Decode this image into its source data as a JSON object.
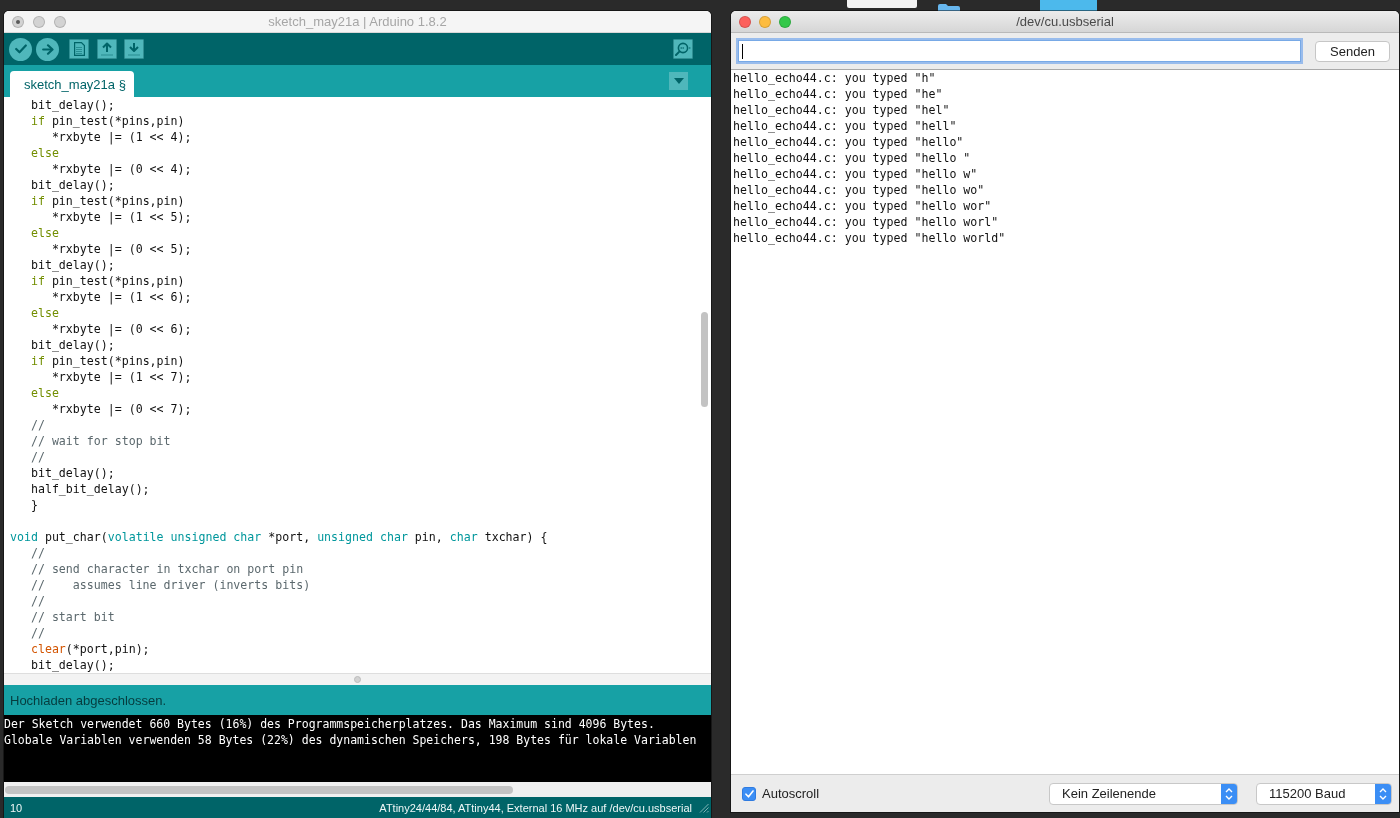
{
  "desktop": {
    "items": [
      {
        "kind": "file"
      },
      {
        "kind": "folder"
      },
      {
        "kind": "tile"
      }
    ]
  },
  "editor_window": {
    "title": "sketch_may21a | Arduino 1.8.2",
    "active": false,
    "edited": true,
    "toolbar": [
      {
        "kind": "verify"
      },
      {
        "kind": "upload"
      },
      {
        "kind": "new"
      },
      {
        "kind": "open"
      },
      {
        "kind": "save"
      },
      {
        "kind": "serial_monitor"
      }
    ],
    "tabs": [
      {
        "label": "sketch_may21a §",
        "selected": true
      }
    ],
    "code_lines": [
      {
        "kind": "block",
        "children": [
          {
            "kind": "code",
            "segments": [
              {
                "kind": "plain",
                "text": "bit_delay();"
              }
            ]
          },
          {
            "kind": "code",
            "segments": [
              {
                "kind": "keyword",
                "text": "if"
              },
              {
                "kind": "plain",
                "text": " pin_test(*pins,pin)"
              }
            ],
            "children": [
              {
                "kind": "code",
                "segments": [
                  {
                    "kind": "plain",
                    "text": "*rxbyte |= (1 << 4);"
                  }
                ]
              }
            ]
          },
          {
            "kind": "code",
            "segments": [
              {
                "kind": "keyword",
                "text": "else"
              }
            ],
            "children": [
              {
                "kind": "code",
                "segments": [
                  {
                    "kind": "plain",
                    "text": "*rxbyte |= (0 << 4);"
                  }
                ]
              }
            ]
          },
          {
            "kind": "code",
            "segments": [
              {
                "kind": "plain",
                "text": "bit_delay();"
              }
            ]
          },
          {
            "kind": "code",
            "segments": [
              {
                "kind": "keyword",
                "text": "if"
              },
              {
                "kind": "plain",
                "text": " pin_test(*pins,pin)"
              }
            ],
            "children": [
              {
                "kind": "code",
                "segments": [
                  {
                    "kind": "plain",
                    "text": "*rxbyte |= (1 << 5);"
                  }
                ]
              }
            ]
          },
          {
            "kind": "code",
            "segments": [
              {
                "kind": "keyword",
                "text": "else"
              }
            ],
            "children": [
              {
                "kind": "code",
                "segments": [
                  {
                    "kind": "plain",
                    "text": "*rxbyte |= (0 << 5);"
                  }
                ]
              }
            ]
          },
          {
            "kind": "code",
            "segments": [
              {
                "kind": "plain",
                "text": "bit_delay();"
              }
            ]
          },
          {
            "kind": "code",
            "segments": [
              {
                "kind": "keyword",
                "text": "if"
              },
              {
                "kind": "plain",
                "text": " pin_test(*pins,pin)"
              }
            ],
            "children": [
              {
                "kind": "code",
                "segments": [
                  {
                    "kind": "plain",
                    "text": "*rxbyte |= (1 << 6);"
                  }
                ]
              }
            ]
          },
          {
            "kind": "code",
            "segments": [
              {
                "kind": "keyword",
                "text": "else"
              }
            ],
            "children": [
              {
                "kind": "code",
                "segments": [
                  {
                    "kind": "plain",
                    "text": "*rxbyte |= (0 << 6);"
                  }
                ]
              }
            ]
          },
          {
            "kind": "code",
            "segments": [
              {
                "kind": "plain",
                "text": "bit_delay();"
              }
            ]
          },
          {
            "kind": "code",
            "segments": [
              {
                "kind": "keyword",
                "text": "if"
              },
              {
                "kind": "plain",
                "text": " pin_test(*pins,pin)"
              }
            ],
            "children": [
              {
                "kind": "code",
                "segments": [
                  {
                    "kind": "plain",
                    "text": "*rxbyte |= (1 << 7);"
                  }
                ]
              }
            ]
          },
          {
            "kind": "code",
            "segments": [
              {
                "kind": "keyword",
                "text": "else"
              }
            ],
            "children": [
              {
                "kind": "code",
                "segments": [
                  {
                    "kind": "plain",
                    "text": "*rxbyte |= (0 << 7);"
                  }
                ]
              }
            ]
          },
          {
            "kind": "code",
            "segments": [
              {
                "kind": "comment",
                "text": "//"
              }
            ]
          },
          {
            "kind": "code",
            "segments": [
              {
                "kind": "comment",
                "text": "// wait for stop bit"
              }
            ]
          },
          {
            "kind": "code",
            "segments": [
              {
                "kind": "comment",
                "text": "//"
              }
            ]
          },
          {
            "kind": "code",
            "segments": [
              {
                "kind": "plain",
                "text": "bit_delay();"
              }
            ]
          },
          {
            "kind": "code",
            "segments": [
              {
                "kind": "plain",
                "text": "half_bit_delay();"
              }
            ]
          },
          {
            "kind": "code",
            "segments": [
              {
                "kind": "plain",
                "text": "}"
              }
            ]
          }
        ]
      },
      {
        "kind": "blank"
      },
      {
        "kind": "code",
        "segments": [
          {
            "kind": "type",
            "text": "void"
          },
          {
            "kind": "plain",
            "text": " put_char("
          },
          {
            "kind": "type",
            "text": "volatile unsigned char"
          },
          {
            "kind": "plain",
            "text": " *port, "
          },
          {
            "kind": "type",
            "text": "unsigned char"
          },
          {
            "kind": "plain",
            "text": " pin, "
          },
          {
            "kind": "type",
            "text": "char"
          },
          {
            "kind": "plain",
            "text": " txchar) {"
          }
        ],
        "children": [
          {
            "kind": "code",
            "segments": [
              {
                "kind": "comment",
                "text": "//"
              }
            ]
          },
          {
            "kind": "code",
            "segments": [
              {
                "kind": "comment",
                "text": "// send character in txchar on port pin"
              }
            ]
          },
          {
            "kind": "code",
            "segments": [
              {
                "kind": "comment",
                "text": "//    assumes line driver (inverts bits)"
              }
            ]
          },
          {
            "kind": "code",
            "segments": [
              {
                "kind": "comment",
                "text": "//"
              }
            ]
          },
          {
            "kind": "code",
            "segments": [
              {
                "kind": "comment",
                "text": "// start bit"
              }
            ]
          },
          {
            "kind": "code",
            "segments": [
              {
                "kind": "comment",
                "text": "//"
              }
            ]
          },
          {
            "kind": "code",
            "segments": [
              {
                "kind": "function",
                "text": "clear"
              },
              {
                "kind": "plain",
                "text": "(*port,pin);"
              }
            ]
          },
          {
            "kind": "code",
            "segments": [
              {
                "kind": "plain",
                "text": "bit_delay();"
              }
            ]
          }
        ]
      }
    ],
    "status_message": "Hochladen abgeschlossen.",
    "console_lines": [
      "Der Sketch verwendet 660 Bytes (16%) des Programmspeicherplatzes. Das Maximum sind 4096 Bytes.",
      "Globale Variablen verwenden 58 Bytes (22%) des dynamischen Speichers, 198 Bytes für lokale Variablen"
    ],
    "footer": {
      "line_number": "10",
      "board": "ATtiny24/44/84, ATtiny44, External 16 MHz auf /dev/cu.usbserial"
    }
  },
  "serial_window": {
    "title": "/dev/cu.usbserial",
    "active": true,
    "input": {
      "focused": true
    },
    "send_button": "Senden",
    "output_lines": [
      "hello_echo44.c: you typed \"h\"",
      "hello_echo44.c: you typed \"he\"",
      "hello_echo44.c: you typed \"hel\"",
      "hello_echo44.c: you typed \"hell\"",
      "hello_echo44.c: you typed \"hello\"",
      "hello_echo44.c: you typed \"hello \"",
      "hello_echo44.c: you typed \"hello w\"",
      "hello_echo44.c: you typed \"hello wo\"",
      "hello_echo44.c: you typed \"hello wor\"",
      "hello_echo44.c: you typed \"hello worl\"",
      "hello_echo44.c: you typed \"hello world\""
    ],
    "autoscroll": {
      "label": "Autoscroll",
      "checked": true
    },
    "line_ending": "Kein Zeilenende",
    "baud_rate": "115200 Baud"
  }
}
